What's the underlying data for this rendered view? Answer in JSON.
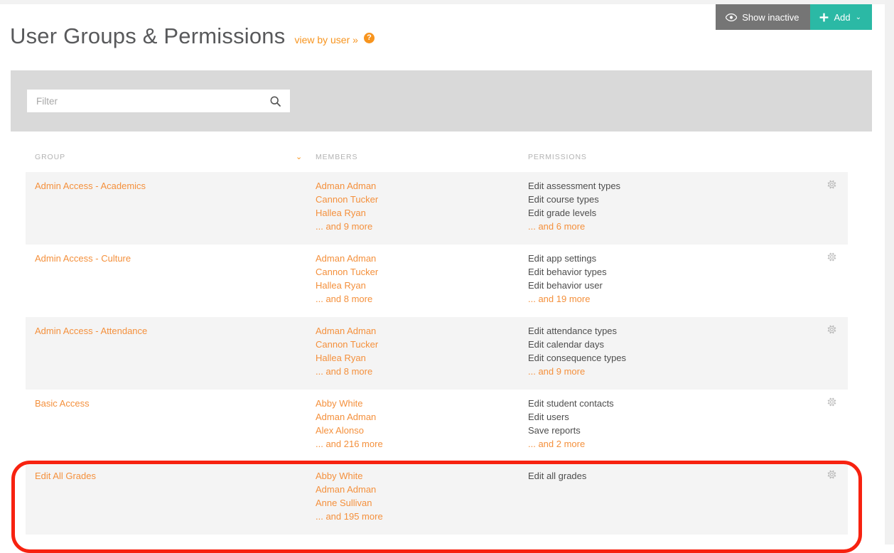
{
  "header": {
    "title": "User Groups & Permissions",
    "view_by_user_link": "view by user »",
    "help_icon_label": "?",
    "show_inactive_label": "Show inactive",
    "show_inactive_icon": "eye-icon",
    "add_label": "Add",
    "add_icon": "plus-icon",
    "add_caret": "⌄",
    "teal_color": "#2bb9a5",
    "gray_color": "#757575",
    "orange_color": "#f7941e"
  },
  "filter": {
    "placeholder": "Filter",
    "value": "",
    "search_icon": "search-icon"
  },
  "table": {
    "columns": {
      "group": "GROUP",
      "members": "MEMBERS",
      "permissions": "PERMISSIONS"
    },
    "sort_caret": "⌄",
    "rows": [
      {
        "group": "Admin Access - Academics",
        "members": [
          "Adman Adman",
          "Cannon Tucker",
          "Hallea Ryan"
        ],
        "members_more": "... and 9 more",
        "permissions": [
          "Edit assessment types",
          "Edit course types",
          "Edit grade levels"
        ],
        "permissions_more": "... and 6 more",
        "gear_icon": "gear-icon"
      },
      {
        "group": "Admin Access - Culture",
        "members": [
          "Adman Adman",
          "Cannon Tucker",
          "Hallea Ryan"
        ],
        "members_more": "... and 8 more",
        "permissions": [
          "Edit app settings",
          "Edit behavior types",
          "Edit behavior user"
        ],
        "permissions_more": "... and 19 more",
        "gear_icon": "gear-icon"
      },
      {
        "group": "Admin Access - Attendance",
        "members": [
          "Adman Adman",
          "Cannon Tucker",
          "Hallea Ryan"
        ],
        "members_more": "... and 8 more",
        "permissions": [
          "Edit attendance types",
          "Edit calendar days",
          "Edit consequence types"
        ],
        "permissions_more": "... and 9 more",
        "gear_icon": "gear-icon"
      },
      {
        "group": "Basic Access",
        "members": [
          "Abby White",
          "Adman Adman",
          "Alex Alonso"
        ],
        "members_more": "... and 216 more",
        "permissions": [
          "Edit student contacts",
          "Edit users",
          "Save reports"
        ],
        "permissions_more": "... and 2 more",
        "gear_icon": "gear-icon"
      },
      {
        "group": "Edit All Grades",
        "members": [
          "Abby White",
          "Adman Adman",
          "Anne Sullivan"
        ],
        "members_more": "... and 195 more",
        "permissions": [
          "Edit all grades"
        ],
        "permissions_more": "",
        "gear_icon": "gear-icon"
      }
    ]
  },
  "annotation": {
    "color": "#f72210",
    "target_row_index": 4
  }
}
